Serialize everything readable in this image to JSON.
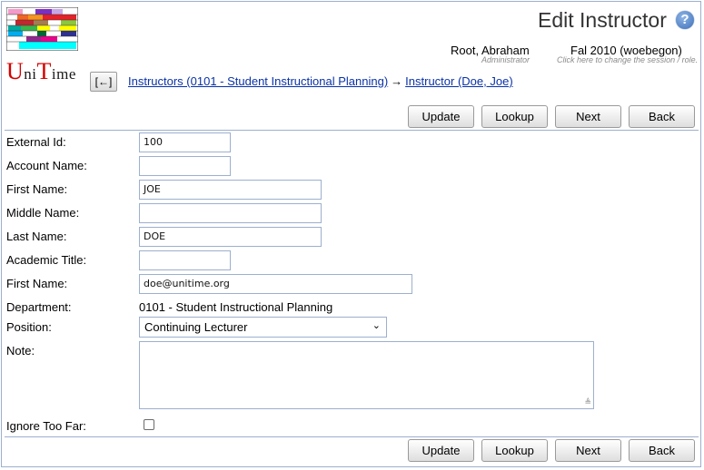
{
  "header": {
    "logo_text": [
      "U",
      "ni",
      "T",
      "ime"
    ],
    "title": "Edit Instructor",
    "help_label": "?",
    "user": "Root, Abraham",
    "role": "Administrator",
    "session": "Fal 2010 (woebegon)",
    "session_hint": "Click here to change the session / role."
  },
  "nav": {
    "back_label": "[←]",
    "crumb1": "Instructors (0101 - Student Instructional Planning)",
    "arrow": "→",
    "crumb2": "Instructor (Doe, Joe)"
  },
  "buttons": {
    "update": "Update",
    "lookup": "Lookup",
    "next": "Next",
    "back": "Back"
  },
  "form": {
    "external_id": {
      "label": "External Id:",
      "value": "100"
    },
    "account_name": {
      "label": "Account Name:",
      "value": ""
    },
    "first_name": {
      "label": "First Name:",
      "value": "JOE"
    },
    "middle_name": {
      "label": "Middle Name:",
      "value": ""
    },
    "last_name": {
      "label": "Last Name:",
      "value": "DOE"
    },
    "academic_title": {
      "label": "Academic Title:",
      "value": ""
    },
    "email": {
      "label": "First Name:",
      "value": "doe@unitime.org"
    },
    "department": {
      "label": "Department:",
      "value": "0101 - Student Instructional Planning"
    },
    "position": {
      "label": "Position:",
      "value": "Continuing Lecturer"
    },
    "note": {
      "label": "Note:",
      "value": ""
    },
    "ignore_too_far": {
      "label": "Ignore Too Far:",
      "checked": false
    }
  },
  "colors": {
    "link": "#0a32a8",
    "border": "#9cb0ce",
    "logo_red": "#d40000"
  }
}
